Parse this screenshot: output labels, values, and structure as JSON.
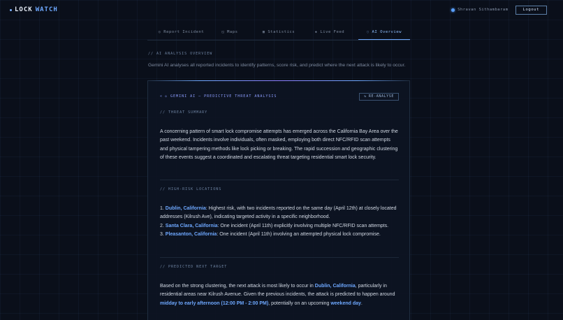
{
  "brand": {
    "prefix": "LOCK",
    "suffix": "WATCH"
  },
  "user": {
    "name": "Shravan Sithambaram",
    "logout_label": "Logout"
  },
  "nav": {
    "tabs": [
      {
        "label": "Report Incident",
        "icon": "◎"
      },
      {
        "label": "Maps",
        "icon": "◱"
      },
      {
        "label": "Statistics",
        "icon": "▦"
      },
      {
        "label": "Live Feed",
        "icon": "◈"
      },
      {
        "label": "AI Overview",
        "icon": "◌"
      }
    ],
    "active": "AI Overview"
  },
  "page": {
    "section_label": "// AI ANALYSIS OVERVIEW",
    "intro": "Gemini AI analyses all reported incidents to identify patterns, score risk, and predict where the next attack is likely to occur."
  },
  "card": {
    "title": "◇ GEMINI AI — PREDICTIVE THREAT ANALYSIS",
    "reanalyse_label": "RE-ANALYSE",
    "threat_summary": {
      "label": "// THREAT SUMMARY",
      "text": "A concerning pattern of smart lock compromise attempts has emerged across the California Bay Area over the past weekend. Incidents involve individuals, often masked, employing both direct NFC/RFID scan attempts and physical tampering methods like lock picking or breaking. The rapid succession and geographic clustering of these events suggest a coordinated and escalating threat targeting residential smart lock security."
    },
    "high_risk": {
      "label": "// HIGH-RISK LOCATIONS",
      "items": [
        {
          "num": "1.",
          "place": "Dublin, California",
          "text": ": Highest risk, with two incidents reported on the same day (April 12th) at closely located addresses (Kilrush Ave), indicating targeted activity in a specific neighborhood."
        },
        {
          "num": "2.",
          "place": "Santa Clara, California",
          "text": ": One incident (April 11th) explicitly involving multiple NFC/RFID scan attempts."
        },
        {
          "num": "3.",
          "place": "Pleasanton, California",
          "text": ": One incident (April 11th) involving an attempted physical lock compromise."
        }
      ]
    },
    "prediction": {
      "label": "// PREDICTED NEXT TARGET",
      "part1": "Based on the strong clustering, the next attack is most likely to occur in ",
      "place": "Dublin, California",
      "part2": ", particularly in residential areas near Kilrush Avenue. Given the previous incidents, the attack is predicted to happen around ",
      "time": "midday to early afternoon (12:00 PM - 2:00 PM)",
      "part3": ", potentially on an upcoming ",
      "day": "weekend day",
      "part4": "."
    }
  }
}
